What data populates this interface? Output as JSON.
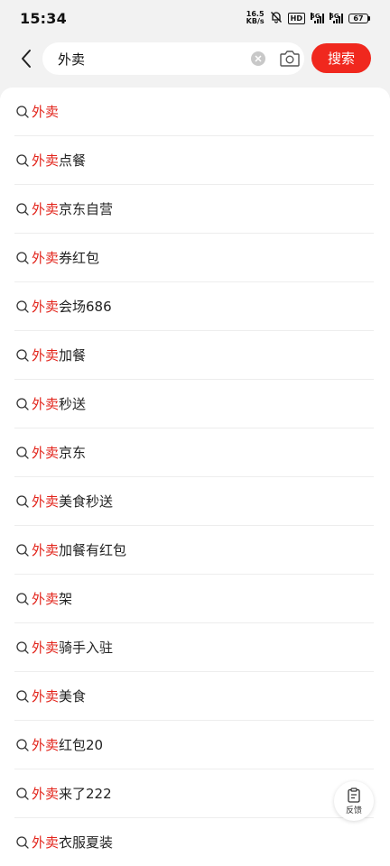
{
  "status": {
    "time": "15:34",
    "net_speed_value": "16.5",
    "net_speed_unit": "KB/s",
    "hd_label": "HD",
    "sig1_label": "5G",
    "sig2_label": "5G",
    "battery": "67"
  },
  "search": {
    "query": "外卖",
    "button_label": "搜索"
  },
  "suggestions": [
    {
      "prefix": "外卖",
      "rest": ""
    },
    {
      "prefix": "外卖",
      "rest": "点餐"
    },
    {
      "prefix": "外卖",
      "rest": "京东自营"
    },
    {
      "prefix": "外卖",
      "rest": "券红包"
    },
    {
      "prefix": "外卖",
      "rest": "会场686"
    },
    {
      "prefix": "外卖",
      "rest": "加餐"
    },
    {
      "prefix": "外卖",
      "rest": "秒送"
    },
    {
      "prefix": "外卖",
      "rest": "京东"
    },
    {
      "prefix": "外卖",
      "rest": "美食秒送"
    },
    {
      "prefix": "外卖",
      "rest": "加餐有红包"
    },
    {
      "prefix": "外卖",
      "rest": "架"
    },
    {
      "prefix": "外卖",
      "rest": "骑手入驻"
    },
    {
      "prefix": "外卖",
      "rest": "美食"
    },
    {
      "prefix": "外卖",
      "rest": "红包20"
    },
    {
      "prefix": "外卖",
      "rest": "来了222"
    },
    {
      "prefix": "外卖",
      "rest": "衣服夏装"
    }
  ],
  "feedback": {
    "label": "反馈"
  },
  "colors": {
    "accent": "#f0281e",
    "highlight": "#e2231a"
  }
}
